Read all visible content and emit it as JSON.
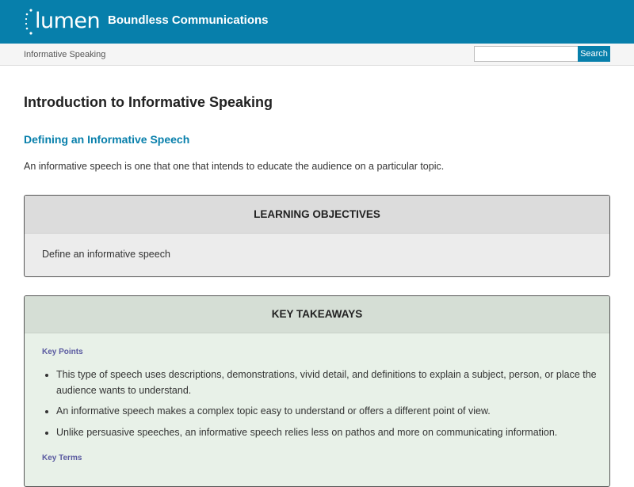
{
  "header": {
    "logo_text": "lumen",
    "site_title": "Boundless Communications"
  },
  "subbar": {
    "breadcrumb": "Informative Speaking",
    "search_placeholder": "",
    "search_button": "Search"
  },
  "main": {
    "page_title": "Introduction to Informative Speaking",
    "section_heading": "Defining an Informative Speech",
    "intro_text": "An informative speech is one that one that intends to educate the audience on a particular topic."
  },
  "learning_objectives": {
    "title": "LEARNING OBJECTIVES",
    "items": [
      "Define an informative speech"
    ]
  },
  "key_takeaways": {
    "title": "KEY TAKEAWAYS",
    "points_label": "Key Points",
    "points": [
      "This type of speech uses descriptions, demonstrations, vivid detail, and definitions to explain a subject, person, or place the audience wants to understand.",
      "An informative speech makes a complex topic easy to understand or offers a different point of view.",
      "Unlike persuasive speeches, an informative speech relies less on pathos and more on communicating information."
    ],
    "terms_label": "Key Terms"
  },
  "colors": {
    "brand": "#077fab",
    "heading_link": "#077fab",
    "key_label": "#5a5aa0",
    "takeaways_bg": "#e8f1e8",
    "objectives_bg": "#ececec"
  }
}
